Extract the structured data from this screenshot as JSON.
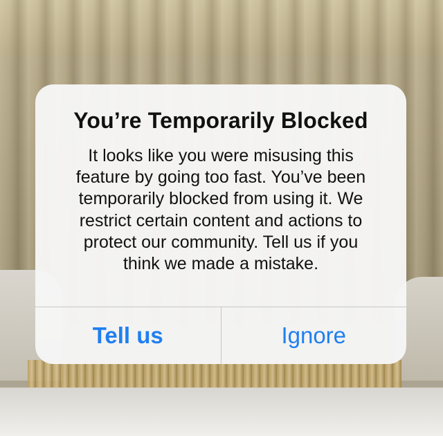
{
  "alert": {
    "title": "You’re Temporarily Blocked",
    "message_lines": [
      "It looks like you were misusing this",
      "feature by going too fast. You’ve been",
      "temporarily blocked from using it. We",
      "restrict certain content and actions to",
      "protect our community. Tell us if you",
      "think we made a mistake."
    ],
    "buttons": {
      "tell_us_label": "Tell us",
      "ignore_label": "Ignore"
    }
  },
  "colors": {
    "accent": "#1f7ff0",
    "dialog_background": "#f6f6f6",
    "separator": "#c6c6c8"
  }
}
